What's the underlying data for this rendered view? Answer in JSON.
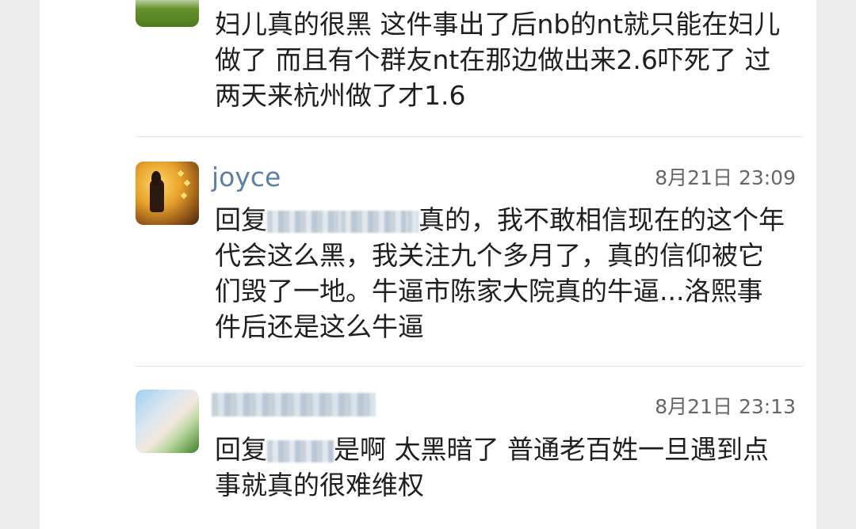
{
  "feed": {
    "comments": [
      {
        "username": "",
        "timestamp": "",
        "text": "妇儿真的很黑 这件事出了后nb的nt就只能在妇儿做了 而且有个群友nt在那边做出来2.6吓死了 过两天来杭州做了才1.6"
      },
      {
        "username": "joyce",
        "timestamp": "8月21日 23:09",
        "reply_prefix": "回复",
        "text": "真的，我不敢相信现在的这个年代会这么黑，我关注九个多月了，真的信仰被它们毁了一地。牛逼市陈家大院真的牛逼...洛熙事件后还是这么牛逼"
      },
      {
        "username": "",
        "timestamp": "8月21日 23:13",
        "reply_prefix": "回复",
        "text": "是啊 太黑暗了 普通老百姓一旦遇到点事就真的很难维权"
      }
    ]
  }
}
